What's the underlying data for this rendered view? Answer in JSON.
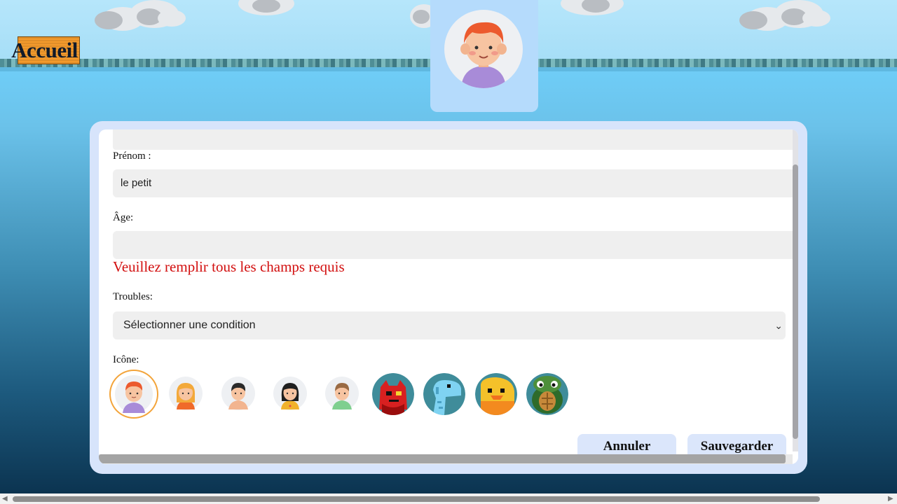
{
  "header": {
    "home_label": "Accueil"
  },
  "form": {
    "first_name_label": "Prénom :",
    "first_name_value": "le petit",
    "age_label": "Âge:",
    "age_value": "",
    "error_message": "Veuillez remplir tous les champs requis",
    "troubles_label": "Troubles:",
    "troubles_selected": "Sélectionner une condition",
    "icon_label": "Icône:",
    "icons": [
      "red-hair-boy-avatar",
      "blonde-girl-avatar",
      "black-hair-boy-avatar",
      "black-hair-girl-avatar",
      "brown-hair-boy-avatar",
      "red-monster-avatar",
      "blue-dinosaur-avatar",
      "yellow-bird-avatar",
      "turtle-avatar"
    ],
    "selected_icon": "red-hair-boy-avatar",
    "cancel_label": "Annuler",
    "save_label": "Sauvegarder"
  },
  "colors": {
    "accent": "#f39a2c",
    "error": "#d20f0f",
    "panel": "#d7e4fb",
    "button": "#dbe6fb"
  }
}
